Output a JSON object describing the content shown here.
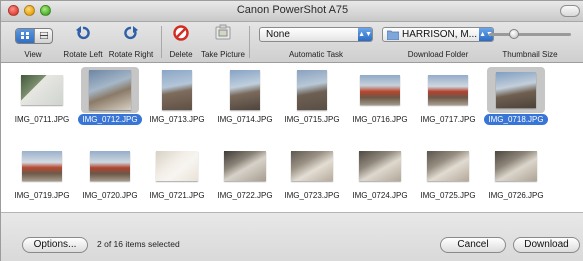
{
  "window": {
    "title": "Canon PowerShot A75"
  },
  "toolbar": {
    "view_label": "View",
    "rotate_left_label": "Rotate Left",
    "rotate_right_label": "Rotate Right",
    "delete_label": "Delete",
    "take_picture_label": "Take Picture",
    "automatic_task_value": "None",
    "automatic_task_label": "Automatic Task",
    "download_folder_value": "HARRISON, M...",
    "download_folder_label": "Download Folder",
    "thumbnail_size_label": "Thumbnail Size",
    "thumbnail_size_level": 0.3
  },
  "images": [
    {
      "name": "IMG_0711.JPG",
      "selected": false
    },
    {
      "name": "IMG_0712.JPG",
      "selected": true
    },
    {
      "name": "IMG_0713.JPG",
      "selected": false
    },
    {
      "name": "IMG_0714.JPG",
      "selected": false
    },
    {
      "name": "IMG_0715.JPG",
      "selected": false
    },
    {
      "name": "IMG_0716.JPG",
      "selected": false
    },
    {
      "name": "IMG_0717.JPG",
      "selected": false
    },
    {
      "name": "IMG_0718.JPG",
      "selected": true
    },
    {
      "name": "IMG_0719.JPG",
      "selected": false
    },
    {
      "name": "IMG_0720.JPG",
      "selected": false
    },
    {
      "name": "IMG_0721.JPG",
      "selected": false
    },
    {
      "name": "IMG_0722.JPG",
      "selected": false
    },
    {
      "name": "IMG_0723.JPG",
      "selected": false
    },
    {
      "name": "IMG_0724.JPG",
      "selected": false
    },
    {
      "name": "IMG_0725.JPG",
      "selected": false
    },
    {
      "name": "IMG_0726.JPG",
      "selected": false
    }
  ],
  "footer": {
    "options_label": "Options...",
    "status": "2 of 16 items selected",
    "cancel_label": "Cancel",
    "download_label": "Download"
  },
  "colors": {
    "selection_blue": "#3875d7",
    "selection_box": "#c6c6c6"
  }
}
